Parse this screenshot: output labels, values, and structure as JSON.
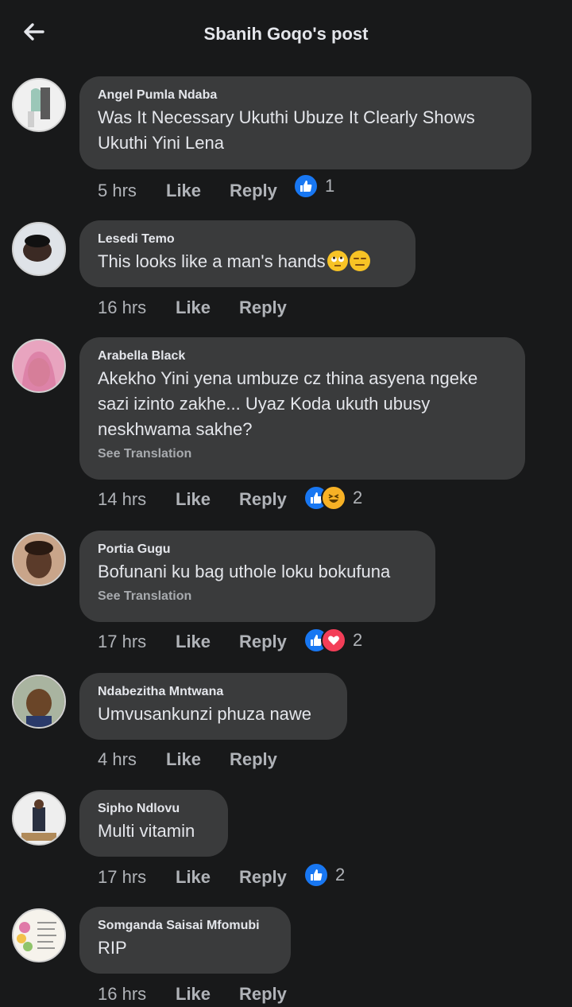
{
  "header": {
    "title": "Sbanih Goqo's post"
  },
  "colors": {
    "like_blue": "#1877f2",
    "bubble": "#3a3b3c",
    "background": "#18191a"
  },
  "comments": [
    {
      "author": "Angel Pumla Ndaba",
      "text": "Was It Necessary Ukuthi Ubuze It Clearly  Shows Ukuthi Yini Lena",
      "time": "5 hrs",
      "like": "Like",
      "reply": "Reply",
      "reaction_count": "1",
      "reactions": [
        "like-icon"
      ]
    },
    {
      "author": "Lesedi Temo",
      "text": "This looks like a man's hands",
      "emojis": [
        "eye-roll-emoji",
        "expressionless-emoji"
      ],
      "time": "16 hrs",
      "like": "Like",
      "reply": "Reply"
    },
    {
      "author": "Arabella Black",
      "text": "Akekho Yini yena umbuze cz thina asyena ngeke sazi izinto zakhe... Uyaz Koda ukuth ubusy neskhwama sakhe?",
      "translation": "See Translation",
      "time": "14 hrs",
      "like": "Like",
      "reply": "Reply",
      "reaction_count": "2",
      "reactions": [
        "like-icon",
        "haha-icon"
      ]
    },
    {
      "author": "Portia Gugu",
      "text": "Bofunani ku bag uthole loku bokufuna",
      "translation": "See Translation",
      "time": "17 hrs",
      "like": "Like",
      "reply": "Reply",
      "reaction_count": "2",
      "reactions": [
        "like-icon",
        "love-icon"
      ]
    },
    {
      "author": "Ndabezitha Mntwana",
      "text": "Umvusankunzi phuza nawe",
      "time": "4 hrs",
      "like": "Like",
      "reply": "Reply"
    },
    {
      "author": "Sipho Ndlovu",
      "text": "Multi vitamin",
      "time": "17 hrs",
      "like": "Like",
      "reply": "Reply",
      "reaction_count": "2",
      "reactions": [
        "like-icon"
      ]
    },
    {
      "author": "Somganda Saisai Mfomubi",
      "text": "RIP",
      "time": "16 hrs",
      "like": "Like",
      "reply": "Reply"
    }
  ]
}
